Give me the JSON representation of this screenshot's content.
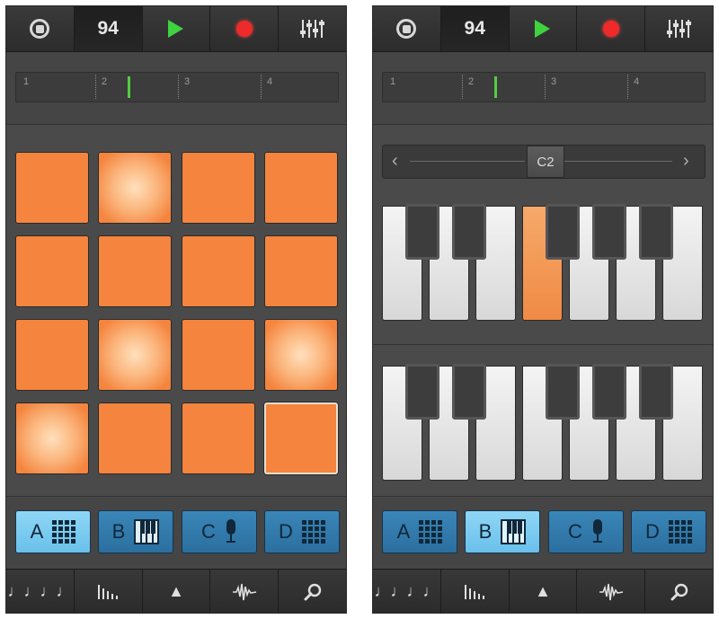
{
  "toolbar": {
    "tempo": "94",
    "stop_icon": "stop-circle-icon",
    "play_icon": "play-icon",
    "record_icon": "record-icon",
    "mixer_icon": "mixer-sliders-icon"
  },
  "ruler": {
    "bars": [
      "1",
      "2",
      "3",
      "4"
    ]
  },
  "pads": {
    "rows": 4,
    "cols": 4,
    "lit": [
      1,
      9,
      11,
      12
    ],
    "selected": 15,
    "color": "#f4843e"
  },
  "keyboard": {
    "octave_label": "C2",
    "prev_arrow": "‹",
    "next_arrow": "›",
    "pressed_key_color": "#f08a44"
  },
  "banks": [
    {
      "letter": "A",
      "icon": "grid-icon"
    },
    {
      "letter": "B",
      "icon": "keyboard-icon"
    },
    {
      "letter": "C",
      "icon": "microphone-icon"
    },
    {
      "letter": "D",
      "icon": "grid-icon"
    }
  ],
  "left_active_bank": "A",
  "right_active_bank": "B",
  "bottombar": {
    "notes_label": "♩♩♩♩",
    "up_label": "▲"
  }
}
